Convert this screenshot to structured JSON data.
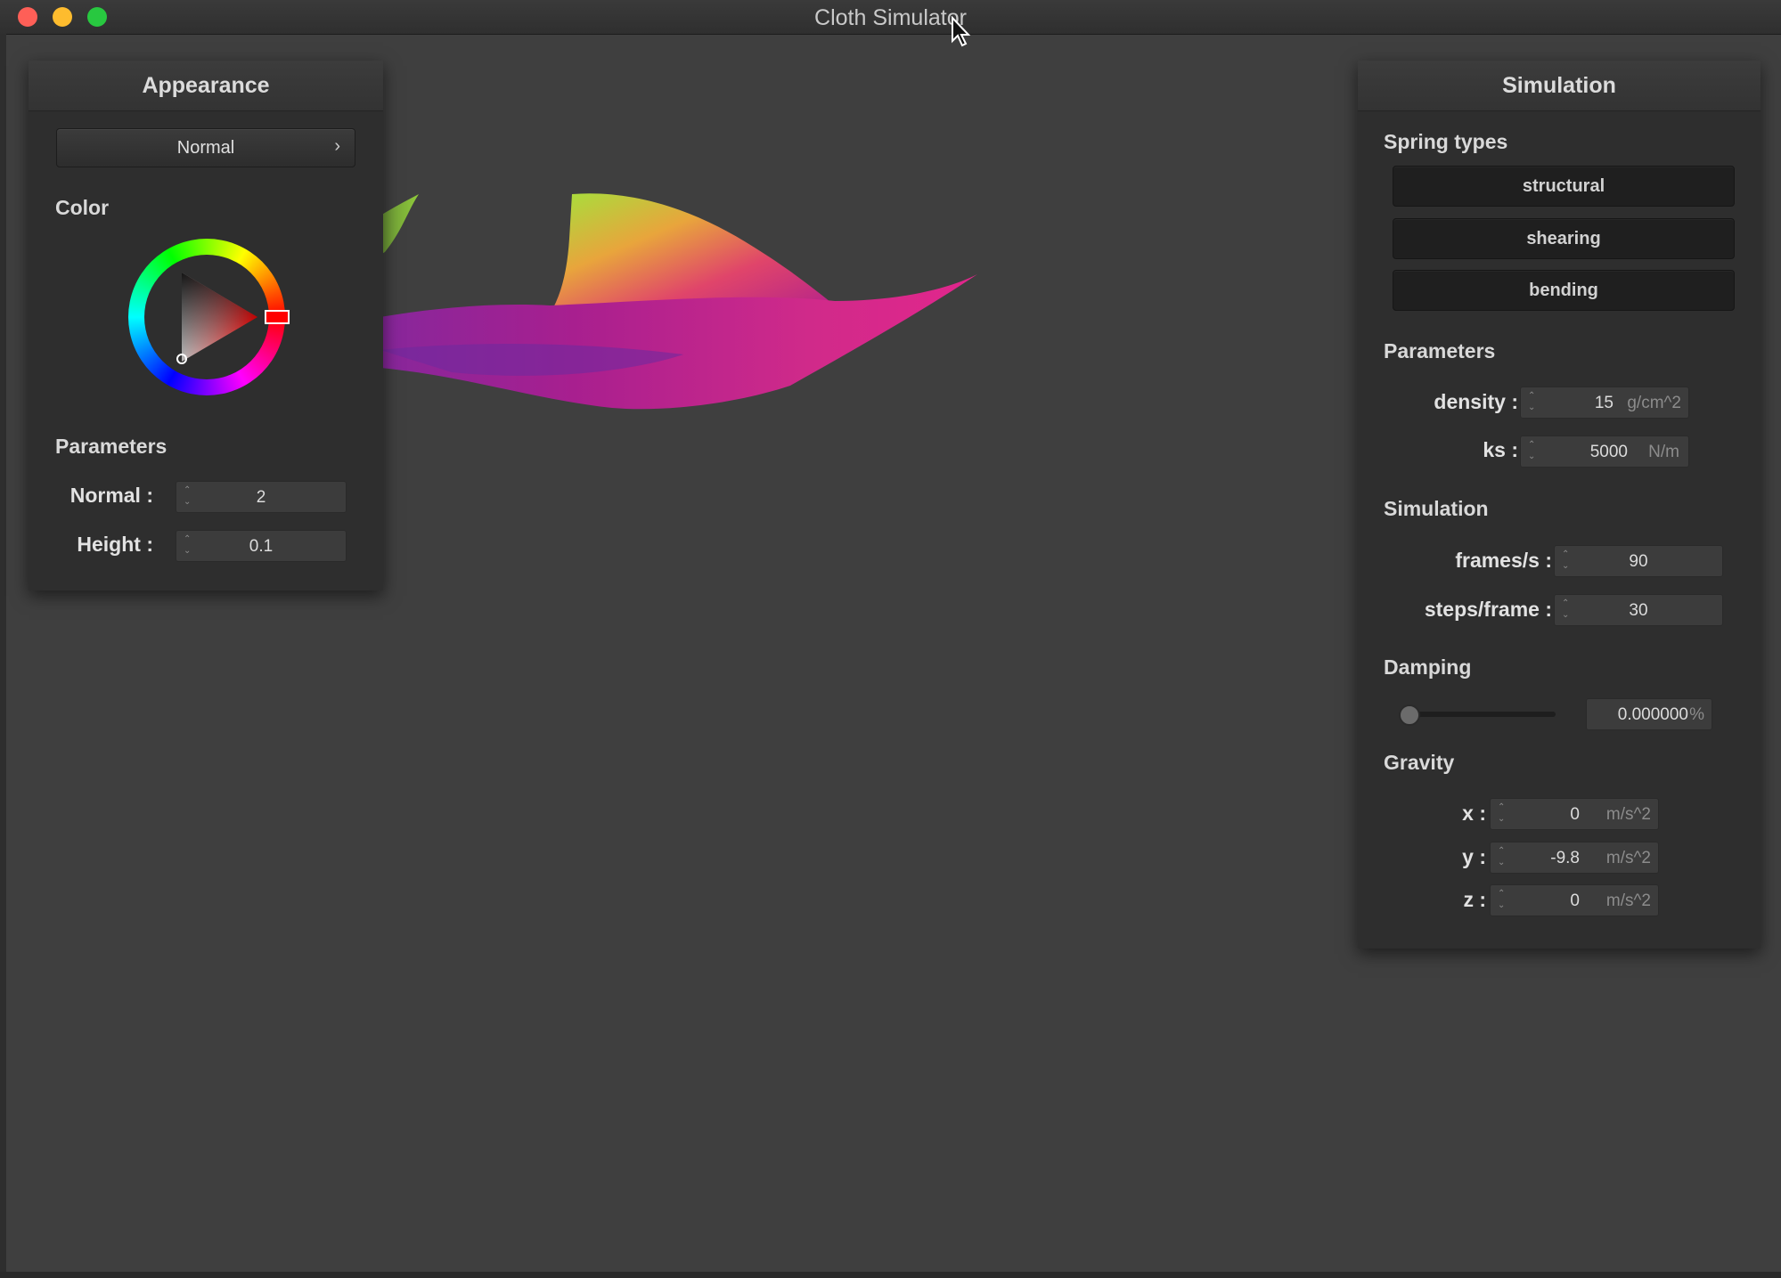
{
  "window": {
    "title": "Cloth Simulator"
  },
  "appearance_panel": {
    "title": "Appearance",
    "shader_dropdown": {
      "selected": "Normal",
      "arrow": "›"
    },
    "color_label": "Color",
    "color": {
      "hue": "#ff0000"
    },
    "parameters_label": "Parameters",
    "normal": {
      "label": "Normal :",
      "value": "2"
    },
    "height": {
      "label": "Height :",
      "value": "0.1"
    }
  },
  "simulation_panel": {
    "title": "Simulation",
    "spring_types_label": "Spring types",
    "spring_buttons": [
      "structural",
      "shearing",
      "bending"
    ],
    "parameters_label": "Parameters",
    "density": {
      "label": "density :",
      "value": "15",
      "unit": "g/cm^2"
    },
    "ks": {
      "label": "ks :",
      "value": "5000",
      "unit": "N/m"
    },
    "simulation_label": "Simulation",
    "frames": {
      "label": "frames/s :",
      "value": "90"
    },
    "steps": {
      "label": "steps/frame :",
      "value": "30"
    },
    "damping_label": "Damping",
    "damping": {
      "value": "0.000000",
      "unit": "%",
      "fraction": 0
    },
    "gravity_label": "Gravity",
    "gravity": [
      {
        "label": "x :",
        "value": "0",
        "unit": "m/s^2"
      },
      {
        "label": "y :",
        "value": "-9.8",
        "unit": "m/s^2"
      },
      {
        "label": "z :",
        "value": "0",
        "unit": "m/s^2"
      }
    ]
  },
  "icons": {
    "close": "close-icon",
    "minimize": "minimize-icon",
    "maximize": "maximize-icon",
    "cursor": "mouse-cursor-icon",
    "spinner": "spinner-arrows-icon"
  },
  "colors": {
    "close": "#fe5f57",
    "minimize": "#febc2e",
    "maximize": "#28c840",
    "background": "#3f3f3f",
    "panel": "#2e2e2e",
    "cloth_primary": "#b0208f",
    "cloth_highlight": "#9be23a"
  }
}
